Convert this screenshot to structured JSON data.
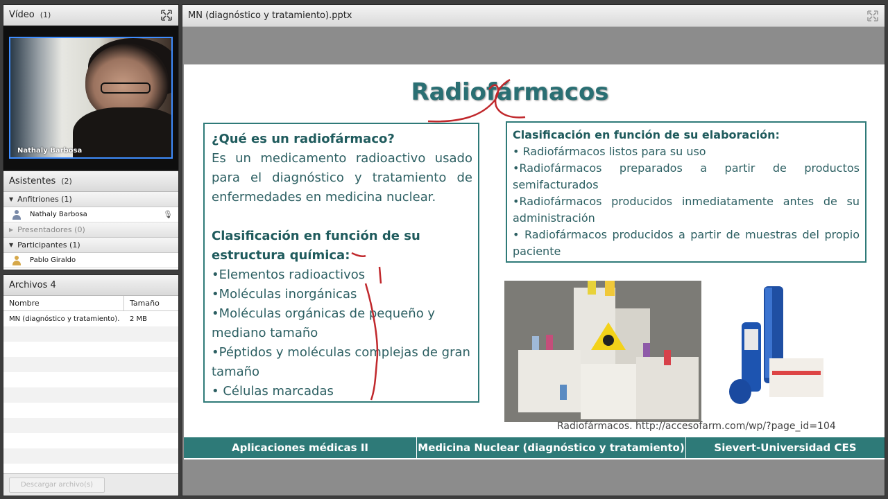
{
  "video_pod": {
    "title": "Vídeo",
    "count": "(1)",
    "presenter_name": "Nathaly Barbosa"
  },
  "attendees_pod": {
    "title": "Asistentes",
    "count": "(2)",
    "groups": [
      {
        "label": "Anfitriones (1)",
        "users": [
          "Nathaly Barbosa"
        ]
      },
      {
        "label": "Presentadores (0)",
        "users": []
      },
      {
        "label": "Participantes (1)",
        "users": [
          "Pablo Giraldo"
        ]
      }
    ]
  },
  "files_pod": {
    "title": "Archivos 4",
    "col_name": "Nombre",
    "col_size": "Tamaño",
    "files": [
      {
        "name": "MN (diagnóstico y tratamiento).",
        "size": "2 MB"
      }
    ],
    "download_button": "Descargar archivo(s)"
  },
  "share_pod": {
    "title": "MN (diagnóstico y tratamiento).pptx"
  },
  "slide": {
    "title": "Radiofármacos",
    "left_box": {
      "question": "¿Qué es un radiofármaco?",
      "answer": "Es un medicamento radioactivo usado para el diagnóstico y tratamiento de enfermedades en medicina nuclear.",
      "classification_heading": "Clasificación en función de su estructura química:",
      "bullets": [
        "•Elementos radioactivos",
        "•Moléculas inorgánicas",
        "•Moléculas orgánicas de pequeño y mediano tamaño",
        "•Péptidos y moléculas complejas de gran tamaño",
        "• Células marcadas"
      ]
    },
    "right_box": {
      "heading": "Clasificación en función de su elaboración:",
      "items": [
        "• Radiofármacos listos para su uso",
        "•Radiofármacos preparados a partir de productos semifacturados",
        "•Radiofármacos producidos inmediatamente antes de su administración",
        "• Radiofármacos producidos a partir de muestras del propio paciente"
      ]
    },
    "caption": "Radiofármacos. http://accesofarm.com/wp/?page_id=104",
    "footer": [
      "Aplicaciones médicas II",
      "Medicina Nuclear (diagnóstico y tratamiento)",
      "Sievert-Universidad CES"
    ]
  },
  "colors": {
    "accent": "#2e7a78",
    "ink": "#c0282c",
    "video_border": "#3f8dff"
  }
}
